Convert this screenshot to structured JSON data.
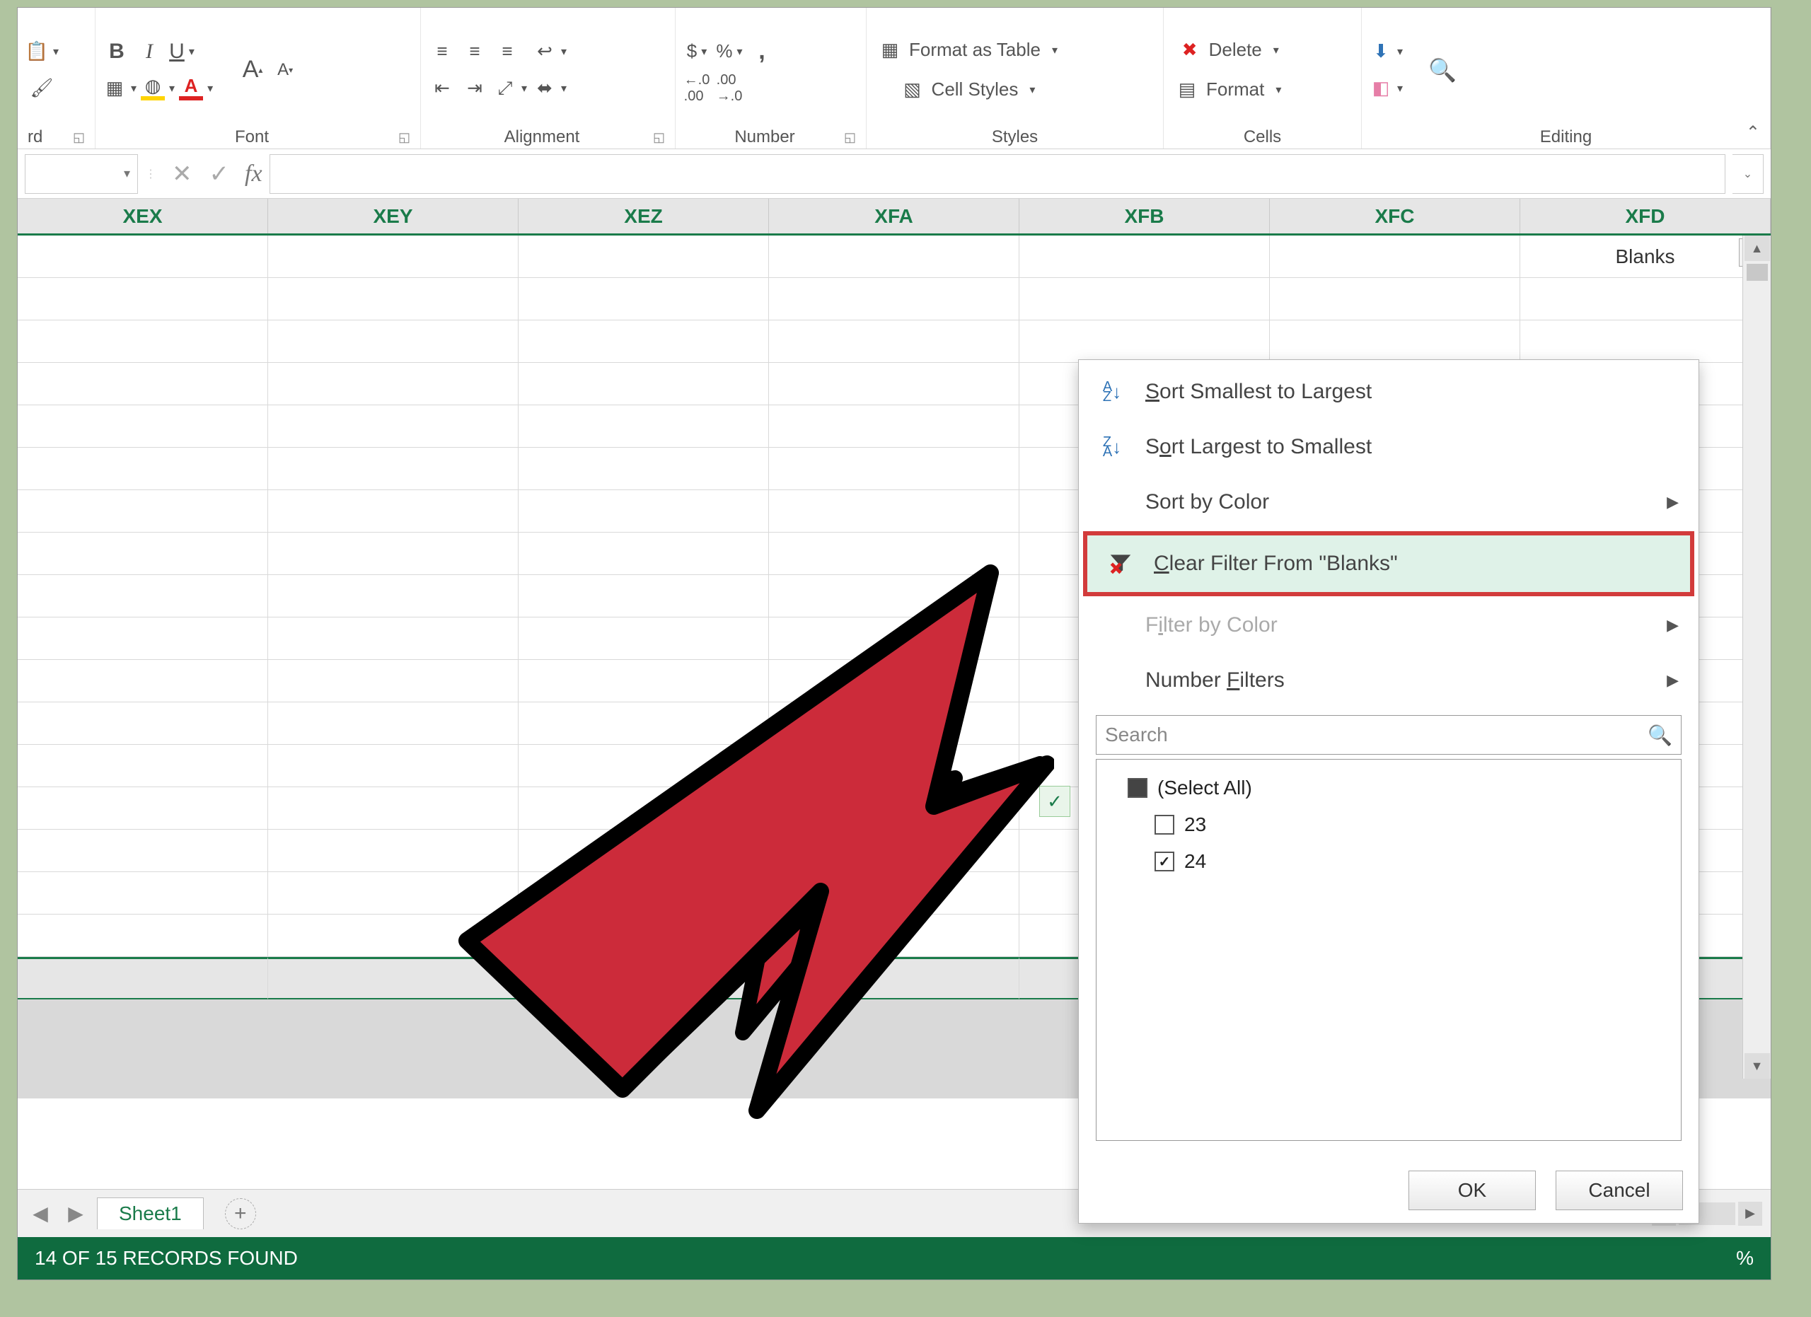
{
  "ribbon": {
    "font": {
      "group_label": "Font",
      "bold": "B",
      "italic": "I",
      "underline": "U",
      "grow": "A",
      "shrink": "A"
    },
    "align": {
      "group_label": "Alignment"
    },
    "number": {
      "group_label": "Number",
      "currency": "$",
      "percent": "%",
      "comma": ",",
      "inc": ".0 .00",
      "dec": ".00 .0"
    },
    "styles": {
      "group_label": "Styles",
      "format_table": "Format as Table",
      "cell_styles": "Cell Styles"
    },
    "cells": {
      "group_label": "Cells",
      "delete": "Delete",
      "format": "Format"
    },
    "editing": {
      "group_label": "Editing"
    }
  },
  "formula_bar": {
    "fx": "fx"
  },
  "columns": [
    "XEX",
    "XEY",
    "XEZ",
    "XFA",
    "XFB",
    "XFC",
    "XFD"
  ],
  "header_cell": "Blanks",
  "filter_menu": {
    "sort_asc": "Sort Smallest to Largest",
    "sort_desc": "Sort Largest to Smallest",
    "sort_color": "Sort by Color",
    "clear_filter": "Clear Filter From \"Blanks\"",
    "filter_color": "Filter by Color",
    "number_filters": "Number Filters",
    "search_placeholder": "Search",
    "select_all": "(Select All)",
    "opt1": "23",
    "opt2": "24",
    "ok": "OK",
    "cancel": "Cancel"
  },
  "tabs": {
    "sheet": "Sheet1"
  },
  "status": {
    "records": "14 OF 15 RECORDS FOUND",
    "pct": "%"
  }
}
